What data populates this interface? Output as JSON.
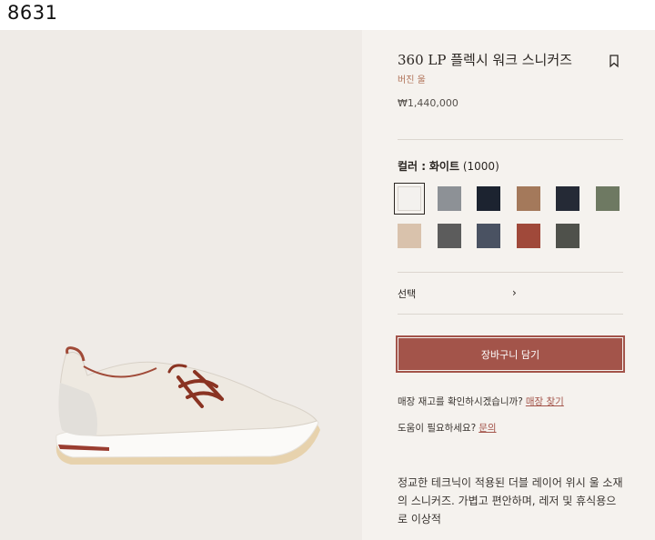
{
  "code_label": "8631",
  "product": {
    "title": "360 LP 플렉시 워크 스니커즈",
    "material": "버진 울",
    "price": "₩1,440,000"
  },
  "color": {
    "label": "컬러 :",
    "selected_name": "화이트",
    "selected_code": "(1000)",
    "swatches": [
      {
        "name": "white",
        "color": "#f3f1ee"
      },
      {
        "name": "light-gray",
        "color": "#8d9196"
      },
      {
        "name": "navy",
        "color": "#1c2330"
      },
      {
        "name": "tan",
        "color": "#a4795b"
      },
      {
        "name": "dark-navy",
        "color": "#252a36"
      },
      {
        "name": "olive",
        "color": "#6e7962"
      },
      {
        "name": "beige-white",
        "color": "#d9c2ac"
      },
      {
        "name": "gray-tweed",
        "color": "#5c5c5c"
      },
      {
        "name": "charcoal-blue",
        "color": "#4a5262"
      },
      {
        "name": "brick-red",
        "color": "#a0493a"
      },
      {
        "name": "dark-olive",
        "color": "#4f514b"
      }
    ]
  },
  "size_select": {
    "label": "선택",
    "chevron": "›"
  },
  "cart_button": "장바구니 담기",
  "store_check": {
    "text": "매장 재고를 확인하시겠습니까?",
    "link": "매장 찾기"
  },
  "help": {
    "text": "도움이 필요하세요?",
    "link": "문의"
  },
  "description": "정교한 테크닉이 적용된 더블 레이어 위시 울 소재의 스니커즈. 가볍고 편안하며, 레저 및 휴식용으로 이상적",
  "icons": [
    "bookmark-icon",
    "chevron-right-icon"
  ],
  "colors": {
    "accent": "#a3544a",
    "material_text": "#b1745a",
    "panel_bg": "#f5f2ee",
    "image_bg": "#efebe7"
  }
}
